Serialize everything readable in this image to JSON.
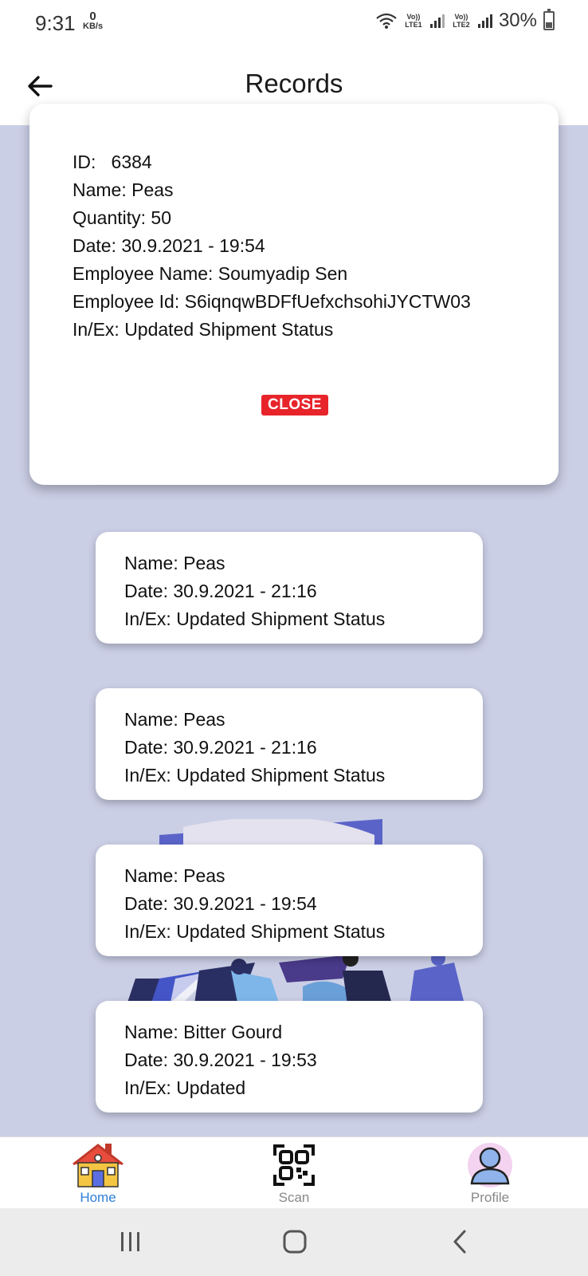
{
  "status_bar": {
    "time": "9:31",
    "net_speed_value": "0",
    "net_speed_unit": "KB/s",
    "sim1_label": "Vo)) LTE1",
    "sim2_label": "Vo)) LTE2",
    "battery": "30%"
  },
  "header": {
    "title": "Records"
  },
  "modal": {
    "lines": [
      "ID:   6384",
      "Name: Peas",
      "Quantity: 50",
      "Date: 30.9.2021 - 19:54",
      "Employee Name: Soumyadip Sen",
      "Employee Id: S6iqnqwBDFfUefxchsohiJYCTW03",
      "In/Ex: Updated Shipment Status"
    ],
    "close_label": "CLOSE",
    "close_color": "#e8242b"
  },
  "records": [
    {
      "name": "Name: Peas",
      "date": "Date: 30.9.2021 - 21:16",
      "inex": "In/Ex: Updated Shipment Status"
    },
    {
      "name": "Name: Peas",
      "date": "Date: 30.9.2021 - 21:16",
      "inex": "In/Ex: Updated Shipment Status"
    },
    {
      "name": "Name: Peas",
      "date": "Date: 30.9.2021 - 19:54",
      "inex": "In/Ex: Updated Shipment Status"
    },
    {
      "name": "Name: Bitter Gourd",
      "date": "Date: 30.9.2021 - 19:53",
      "inex": "In/Ex: Updated"
    }
  ],
  "bottom_nav": {
    "home": "Home",
    "scan": "Scan",
    "profile": "Profile",
    "active_color": "#2f7fd6"
  },
  "icons": {
    "back": "arrow-left-icon",
    "home": "house-icon",
    "scan": "qr-code-icon",
    "profile": "user-avatar-icon"
  },
  "colors": {
    "content_bg": "#cbcfe6"
  }
}
